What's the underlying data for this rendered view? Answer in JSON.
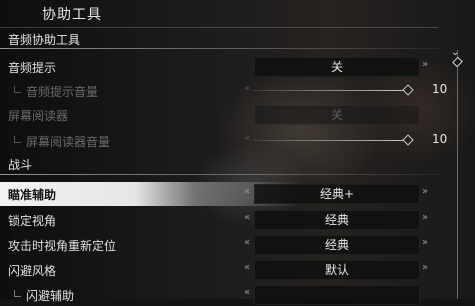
{
  "header": {
    "title": "协助工具"
  },
  "sections": {
    "audio": "音频协助工具",
    "combat": "战斗"
  },
  "rows": {
    "audio_hint": {
      "label": "音频提示",
      "value": "关"
    },
    "audio_hint_volume": {
      "label": "音频提示音量",
      "value": "10",
      "level": 1.0
    },
    "screen_reader": {
      "label": "屏幕阅读器",
      "value": "关"
    },
    "screen_reader_volume": {
      "label": "屏幕阅读器音量",
      "value": "10",
      "level": 1.0
    },
    "aim_assist": {
      "label": "瞄准辅助",
      "value": "经典+"
    },
    "lock_view": {
      "label": "锁定视角",
      "value": "经典"
    },
    "attack_reposition": {
      "label": "攻击时视角重新定位",
      "value": "经典"
    },
    "dodge_style": {
      "label": "闪避风格",
      "value": "默认"
    },
    "dodge_assist": {
      "label": "闪避辅助"
    }
  },
  "glyphs": {
    "left": "«",
    "right": "»",
    "scroll_up": "⌄"
  },
  "icons": [
    "chevron-left-icon",
    "chevron-right-icon",
    "scroll-up-icon",
    "slider-knob-icon"
  ]
}
